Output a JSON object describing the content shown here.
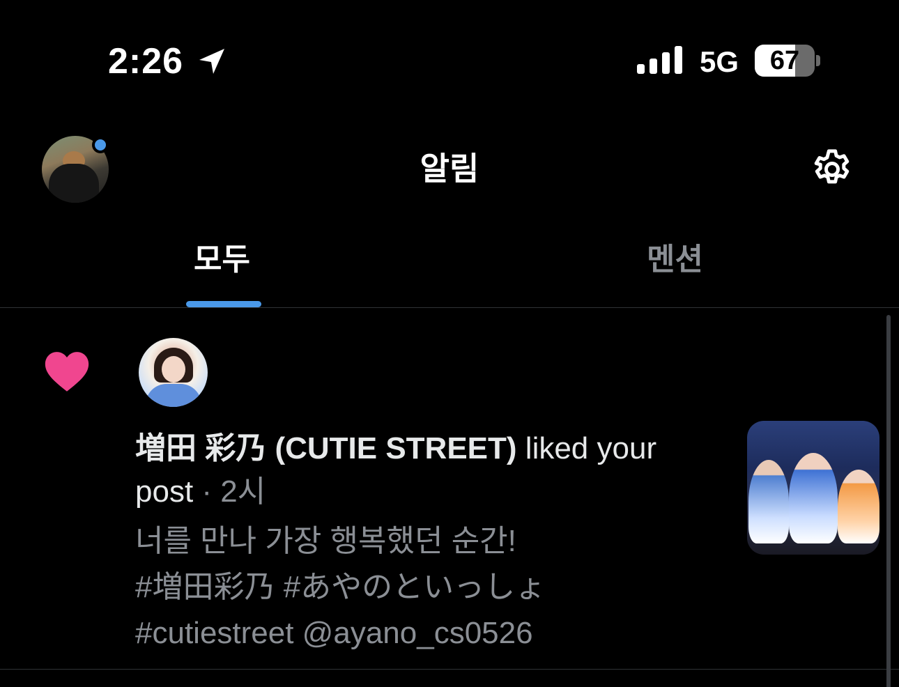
{
  "status_bar": {
    "time": "2:26",
    "network": "5G",
    "battery_percent": "67",
    "battery_level": 0.67
  },
  "header": {
    "title": "알림"
  },
  "tabs": [
    {
      "label": "모두",
      "active": true
    },
    {
      "label": "멘션",
      "active": false
    }
  ],
  "colors": {
    "accent": "#4a99e9",
    "like": "#f91880",
    "secondary_text": "#8b8f95"
  },
  "notification": {
    "icon": "heart-icon",
    "user_name": "増田 彩乃 (CUTIE STREET)",
    "action": "liked your post",
    "action_line1": " liked your",
    "action_line2": "post",
    "time": "2시",
    "separator": " · ",
    "post_lines": [
      "너를 만나 가장 행복했던 순간!",
      "#増田彩乃 #あやのといっしょ",
      "#cutiestreet @ayano_cs0526"
    ]
  }
}
